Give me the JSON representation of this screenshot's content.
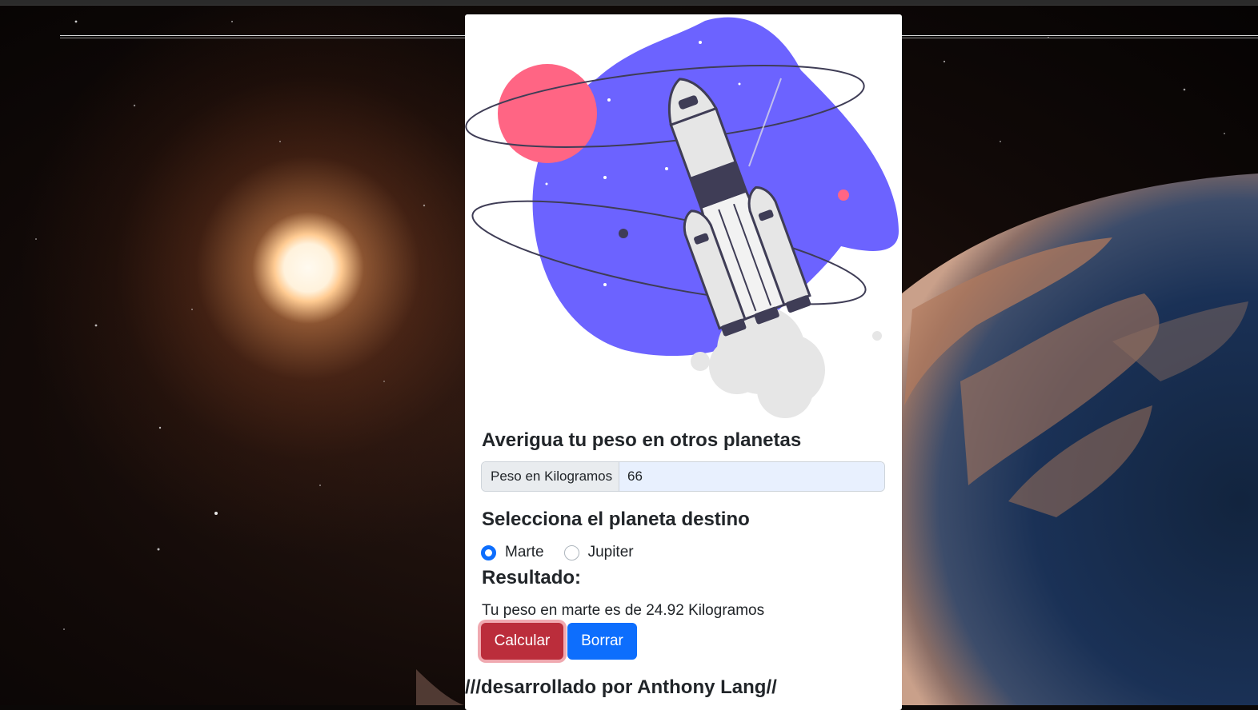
{
  "form": {
    "title": "Averigua tu peso en otros planetas",
    "weight_label": "Peso en Kilogramos",
    "weight_value": "66",
    "planet_heading": "Selecciona el planeta destino",
    "planets": [
      {
        "label": "Marte",
        "checked": true
      },
      {
        "label": "Jupiter",
        "checked": false
      }
    ],
    "result_heading": "Resultado:",
    "result_text": "Tu peso en marte es de 24.92 Kilogramos",
    "calculate_label": "Calcular",
    "clear_label": "Borrar"
  },
  "footer": {
    "credit": "///desarrollado por Anthony Lang//"
  },
  "colors": {
    "illustration_blob": "#6c63ff",
    "planet": "#ff6584",
    "rocket_dark": "#3f3d56",
    "calculate": "#bb2d3b",
    "clear": "#0d6efd"
  }
}
